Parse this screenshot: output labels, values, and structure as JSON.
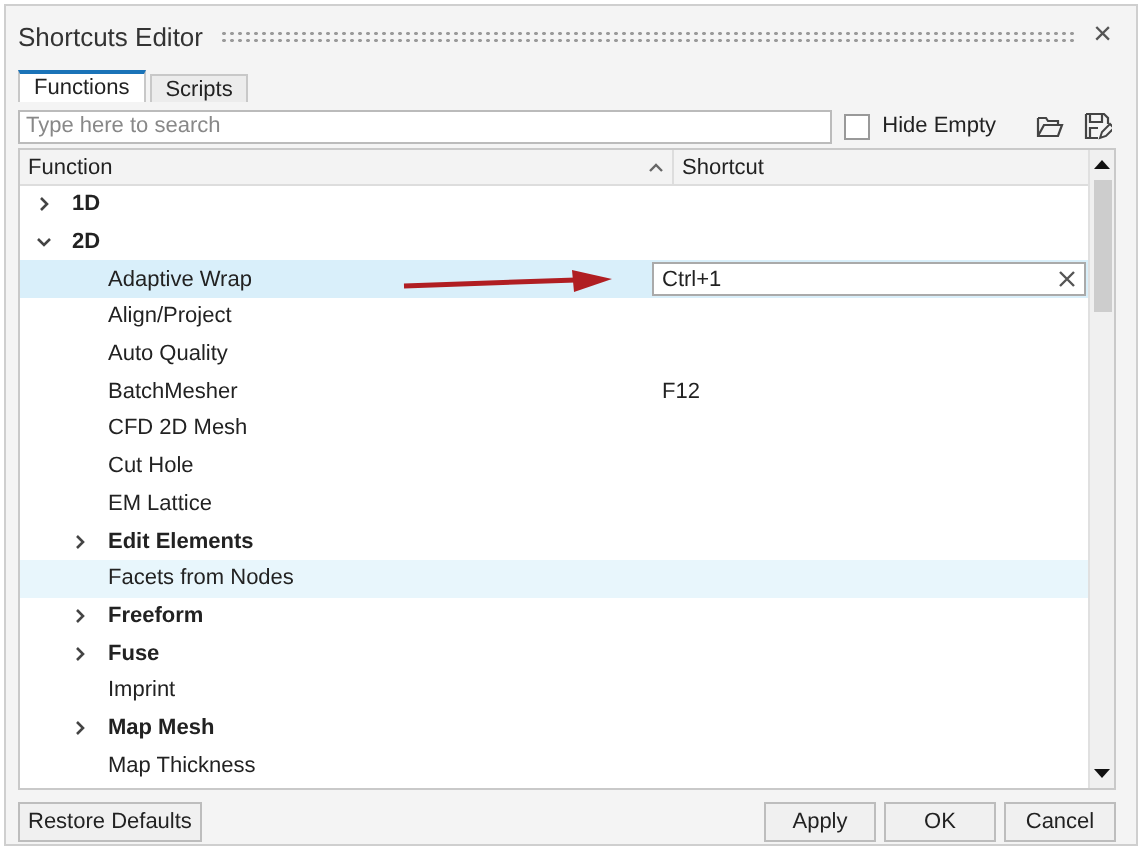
{
  "window": {
    "title": "Shortcuts Editor",
    "close": "×"
  },
  "tabs": [
    {
      "label": "Functions",
      "selected": true
    },
    {
      "label": "Scripts",
      "selected": false
    }
  ],
  "search": {
    "placeholder": "Type here to search"
  },
  "hide_empty": {
    "label": "Hide Empty",
    "checked": false
  },
  "table": {
    "columns": [
      "Function",
      "Shortcut"
    ],
    "rows": [
      {
        "name": "1D",
        "group": true,
        "expanded": false,
        "selected": false,
        "hovered": false
      },
      {
        "name": "2D",
        "group": true,
        "expanded": true,
        "selected": false,
        "hovered": false,
        "children": [
          {
            "name": "Adaptive Wrap",
            "group": false,
            "selected": true,
            "hovered": false,
            "shortcut": "Ctrl+1",
            "editing": true
          },
          {
            "name": "Align/Project",
            "group": false,
            "selected": false,
            "hovered": false
          },
          {
            "name": "Auto Quality",
            "group": false,
            "selected": false,
            "hovered": false
          },
          {
            "name": "BatchMesher",
            "group": false,
            "selected": false,
            "hovered": false,
            "shortcut": "F12",
            "editing": false
          },
          {
            "name": "CFD 2D Mesh",
            "group": false,
            "selected": false,
            "hovered": false
          },
          {
            "name": "Cut Hole",
            "group": false,
            "selected": false,
            "hovered": false
          },
          {
            "name": "EM Lattice",
            "group": false,
            "selected": false,
            "hovered": false
          },
          {
            "name": "Edit Elements",
            "group": true,
            "expanded": false,
            "selected": false,
            "hovered": false
          },
          {
            "name": "Facets from Nodes",
            "group": false,
            "selected": false,
            "hovered": true
          },
          {
            "name": "Freeform",
            "group": true,
            "expanded": false,
            "selected": false,
            "hovered": false
          },
          {
            "name": "Fuse",
            "group": true,
            "expanded": false,
            "selected": false,
            "hovered": false
          },
          {
            "name": "Imprint",
            "group": false,
            "selected": false,
            "hovered": false
          },
          {
            "name": "Map Mesh",
            "group": true,
            "expanded": false,
            "selected": false,
            "hovered": false
          },
          {
            "name": "Map Thickness",
            "group": false,
            "selected": false,
            "hovered": false
          }
        ]
      }
    ]
  },
  "buttons_left": [
    "Restore Defaults"
  ],
  "buttons_right": [
    "Apply",
    "OK",
    "Cancel"
  ]
}
